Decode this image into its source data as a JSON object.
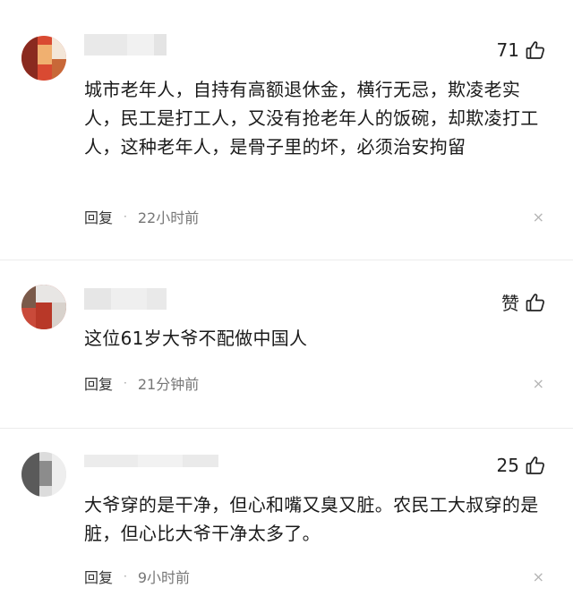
{
  "comments": [
    {
      "likes": "71",
      "text": "城市老年人，自持有高额退休金，横行无忌，欺凌老实人，民工是打工人，又没有抢老年人的饭碗，却欺凌打工人，这种老年人，是骨子里的坏，必须治安拘留",
      "reply_label": "回复",
      "separator": "·",
      "time": "22小时前",
      "close_glyph": "×"
    },
    {
      "likes": "赞",
      "text": "这位61岁大爷不配做中国人",
      "reply_label": "回复",
      "separator": "·",
      "time": "21分钟前",
      "close_glyph": "×"
    },
    {
      "likes": "25",
      "text": "大爷穿的是干净，但心和嘴又臭又脏。农民工大叔穿的是脏，但心比大爷干净太多了。",
      "reply_label": "回复",
      "separator": "·",
      "time": "9小时前",
      "close_glyph": "×"
    }
  ],
  "icons": {
    "like": "thumbs-up-icon",
    "close": "close-icon"
  },
  "colors": {
    "text": "#1a1a1a",
    "meta": "#666666",
    "divider": "#ececec",
    "close": "#b5b5b5"
  }
}
